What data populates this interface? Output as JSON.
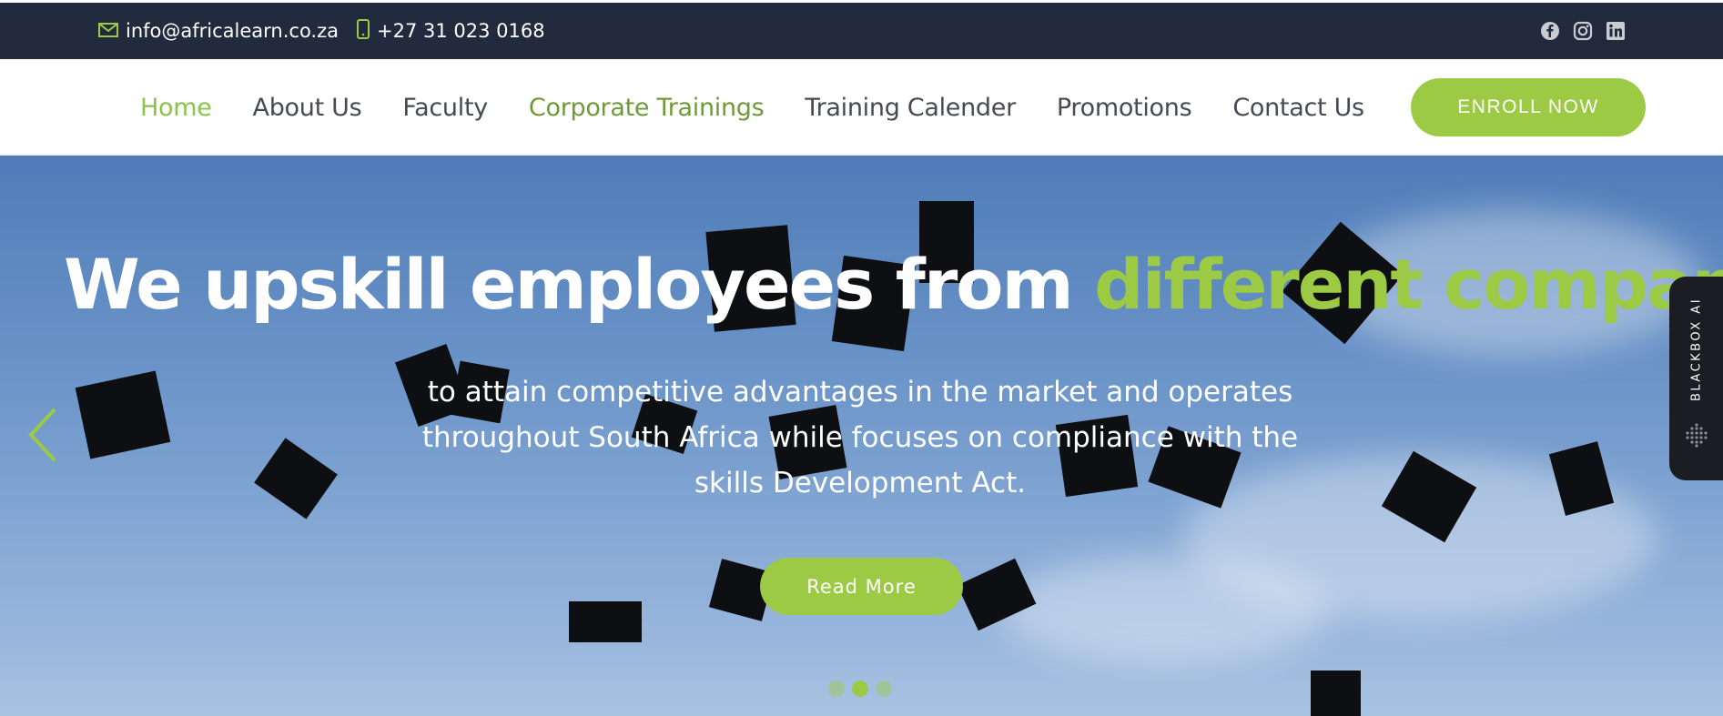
{
  "topbar": {
    "email": "info@africalearn.co.za",
    "phone": "+27 31 023 0168",
    "socials": [
      "facebook-icon",
      "instagram-icon",
      "linkedin-icon"
    ]
  },
  "nav": {
    "items": [
      {
        "label": "Home",
        "state": "active"
      },
      {
        "label": "About Us"
      },
      {
        "label": "Faculty"
      },
      {
        "label": "Corporate Trainings",
        "state": "highlight"
      },
      {
        "label": "Training Calender"
      },
      {
        "label": "Promotions"
      },
      {
        "label": "Contact Us"
      }
    ],
    "cta": "ENROLL NOW"
  },
  "hero": {
    "title_main": "We upskill employees from ",
    "title_accent": "different companies",
    "subtitle": "to attain competitive advantages in the market and operates throughout South Africa while focuses on compliance with the skills Development Act.",
    "button": "Read More",
    "slides_total": 3,
    "slide_active": 2
  },
  "widget": {
    "label": "BLACKBOX AI"
  },
  "colors": {
    "accent": "#9dca45",
    "topbar_bg": "#222a3e",
    "nav_text": "#454a54"
  }
}
